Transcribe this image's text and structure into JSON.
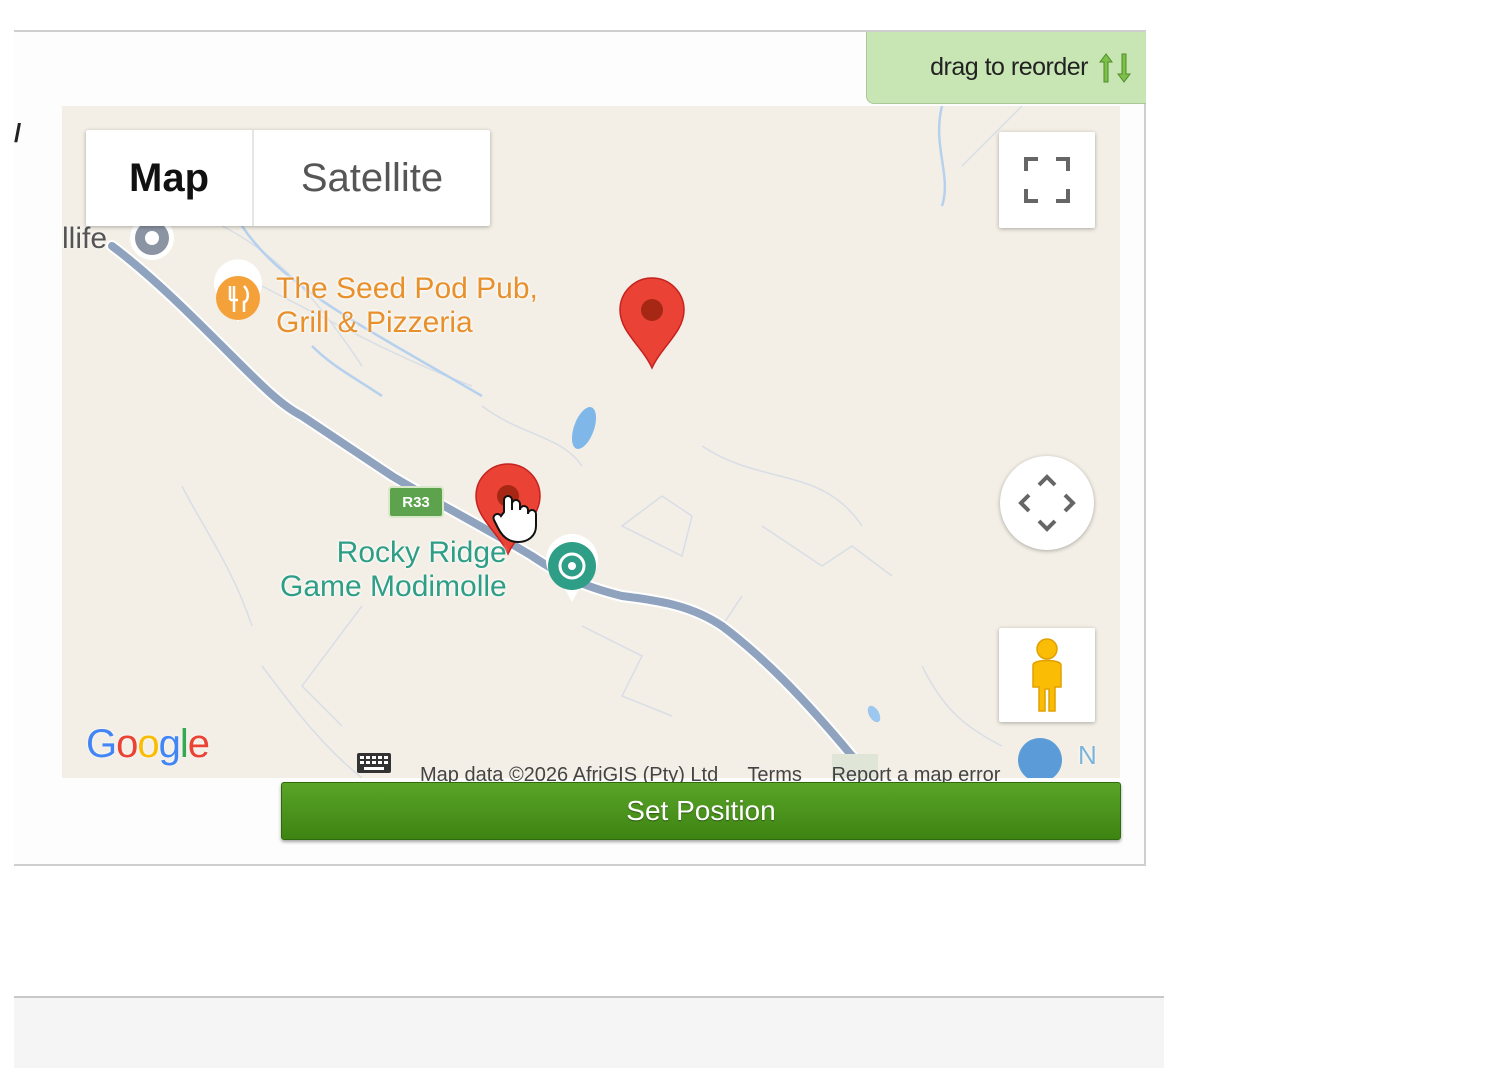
{
  "header": {
    "drag_label": "drag to reorder",
    "stray_mark": "/"
  },
  "map": {
    "type_buttons": {
      "map": "Map",
      "satellite": "Satellite",
      "selected": "Map"
    },
    "pois": {
      "restaurant": {
        "line1": "The Seed Pod Pub,",
        "line2": "Grill & Pizzeria"
      },
      "game_reserve": {
        "line1": "Rocky Ridge",
        "line2": "Game Modimolle"
      },
      "partial_left": "llife",
      "partial_right": "N"
    },
    "route_shield": "R33",
    "logo": {
      "letters": [
        "G",
        "o",
        "o",
        "g",
        "l",
        "e"
      ],
      "colors": [
        "#4285f4",
        "#ea4335",
        "#fbbc05",
        "#4285f4",
        "#34a853",
        "#ea4335"
      ]
    },
    "attribution": {
      "map_data": "Map data ©2026 AfriGIS (Pty) Ltd",
      "terms": "Terms",
      "report": "Report a map error"
    },
    "markers": 2,
    "colors": {
      "road": "#8fa3bf",
      "marker": "#ea4335",
      "water": "#7fb7e8",
      "land": "#f3efe6"
    },
    "icons": [
      "fullscreen-icon",
      "pan-control-icon",
      "pegman-icon",
      "keyboard-icon",
      "restaurant-icon",
      "park-icon",
      "map-marker-icon",
      "hand-cursor-icon"
    ]
  },
  "actions": {
    "set_position": "Set Position"
  }
}
